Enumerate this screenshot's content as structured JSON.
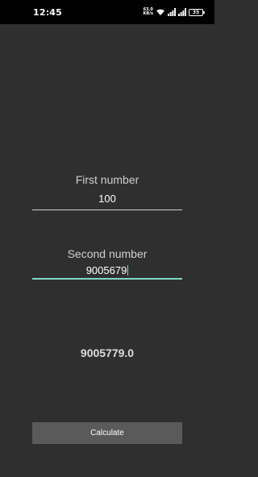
{
  "status_bar": {
    "time": "12:45",
    "net_speed_value": "63.0",
    "net_speed_unit": "KB/s",
    "battery_level": "35",
    "icons": [
      "wifi-icon",
      "signal-icon",
      "signal-icon",
      "battery-icon"
    ]
  },
  "form": {
    "first": {
      "label": "First number",
      "value": "100"
    },
    "second": {
      "label": "Second number",
      "value": "9005679"
    }
  },
  "result": "9005779.0",
  "calculate_label": "Calculate",
  "colors": {
    "background": "#2f2f2f",
    "accent": "#7fd7c6",
    "button": "#5a5a5a"
  }
}
